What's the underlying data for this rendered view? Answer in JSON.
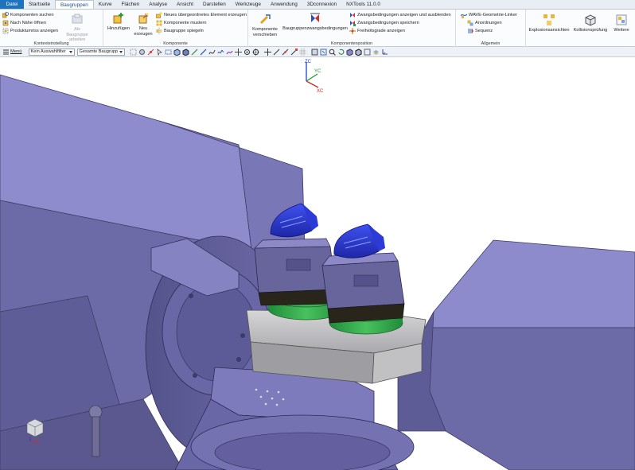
{
  "tabs": [
    {
      "label": "Datei"
    },
    {
      "label": "Startseite"
    },
    {
      "label": "Baugruppen"
    },
    {
      "label": "Kurve"
    },
    {
      "label": "Flächen"
    },
    {
      "label": "Analyse"
    },
    {
      "label": "Ansicht"
    },
    {
      "label": "Darstellen"
    },
    {
      "label": "Werkzeuge"
    },
    {
      "label": "Anwendung"
    },
    {
      "label": "3Dconnexion"
    },
    {
      "label": "NXTools 11.0.0"
    }
  ],
  "ribbon": {
    "kontext": {
      "label": "Kontexteinstellung",
      "items": [
        "Komponenten suchen",
        "Nach Nähe öffnen",
        "Produktumriss anzeigen"
      ],
      "disabled_button": "Als Baugruppe arbeiten"
    },
    "komponente": {
      "label": "Komponente",
      "hinzufuegen": "Hinzufügen",
      "neu": "Neu erzeugen",
      "items": [
        "Neues übergeordnetes Element erzeugen",
        "Komponente mustern",
        "Baugruppe spiegeln"
      ]
    },
    "position": {
      "label": "Komponentenposition",
      "verschieben": "Komponente verschieben",
      "zwang": "Baugruppenzwangsbedingungen",
      "items": [
        "Zwangsbedingungen anzeigen und ausblenden",
        "Zwangsbedingungen speichern",
        "Freiheitsgrade anzeigen"
      ]
    },
    "allgemein": {
      "label": "Allgemein",
      "items": [
        "WAVE-Geometrie-Linker",
        "Anordnungen",
        "Sequenz"
      ]
    },
    "explosion": "Explosionsansichten",
    "kollision": "Kollisionsprüfung",
    "weitere": "Weitere"
  },
  "quickbar": {
    "menu": "Menü",
    "filter": "Kein Auswahlfilter",
    "scope": "Gesamte Baugrupp"
  },
  "triad": {
    "zc": "ZC",
    "yc": "YC",
    "xc": "XC"
  },
  "colors": {
    "tab_file": "#1e73be",
    "machine": "#7673b8",
    "clamp": "#2b36d6",
    "vise": "#5f5d92",
    "pallet": "#bfbfc2",
    "chuck": "#2ca84a"
  }
}
